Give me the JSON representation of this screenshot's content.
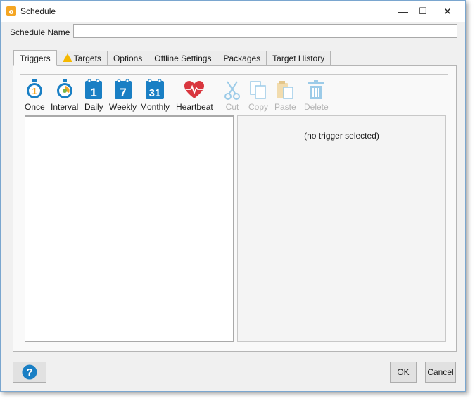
{
  "window": {
    "title": "Schedule",
    "minimize": "—",
    "maximize": "☐",
    "close": "✕"
  },
  "form": {
    "name_label": "Schedule Name",
    "name_value": ""
  },
  "tabs": [
    {
      "label": "Triggers"
    },
    {
      "label": "Targets"
    },
    {
      "label": "Options"
    },
    {
      "label": "Offline Settings"
    },
    {
      "label": "Packages"
    },
    {
      "label": "Target History"
    }
  ],
  "toolbar": {
    "once": "Once",
    "interval": "Interval",
    "daily": "Daily",
    "daily_num": "1",
    "weekly": "Weekly",
    "weekly_num": "7",
    "monthly": "Monthly",
    "monthly_num": "31",
    "heartbeat": "Heartbeat",
    "cut": "Cut",
    "copy": "Copy",
    "paste": "Paste",
    "delete": "Delete"
  },
  "detail": {
    "empty_text": "(no trigger selected)"
  },
  "footer": {
    "help": "?",
    "ok": "OK",
    "cancel": "Cancel"
  },
  "colors": {
    "accent_blue": "#1a7fc4",
    "heart_red": "#d9363e",
    "warning": "#f5b800",
    "orange": "#f5a623",
    "disabled": "#b3b3b3"
  }
}
